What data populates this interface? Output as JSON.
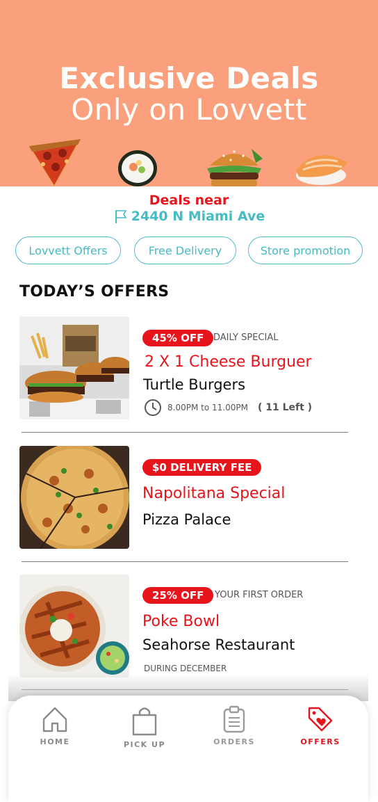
{
  "hero": {
    "line1": "Exclusive Deals",
    "line2": "Only on Lovvett",
    "background": "#fba07c"
  },
  "location": {
    "deals_label": "Deals near",
    "address": "2440 N Miami Ave",
    "icon": "flag-icon"
  },
  "chips": [
    "Lovvett Offers",
    "Free Delivery",
    "Store promotion"
  ],
  "section_title": "TODAY’S OFFERS",
  "offers": [
    {
      "badge": "45% OFF",
      "badge_note": "DAILY SPECIAL",
      "name": "2 X 1 Cheese Burguer",
      "store": "Turtle Burgers",
      "time": "8.00PM to 11.00PM",
      "left": "( 11 Left )"
    },
    {
      "badge": "$0 DELIVERY FEE",
      "name": "Napolitana Special",
      "store": "Pizza Palace"
    },
    {
      "badge": "25% OFF",
      "badge_note": "YOUR FIRST ORDER",
      "name": "Poke Bowl",
      "store": "Seahorse Restaurant",
      "footnote": "DURING DECEMBER"
    }
  ],
  "nav": [
    {
      "label": "HOME",
      "icon": "home-icon",
      "active": false
    },
    {
      "label": "PICK UP",
      "icon": "shopping-bag-icon",
      "active": false
    },
    {
      "label": "ORDERS",
      "icon": "clipboard-icon",
      "active": false
    },
    {
      "label": "OFFERS",
      "icon": "tag-heart-icon",
      "active": true
    }
  ],
  "colors": {
    "accent_red": "#e8141c",
    "teal": "#45bcc4",
    "hero_orange": "#fba07c"
  }
}
